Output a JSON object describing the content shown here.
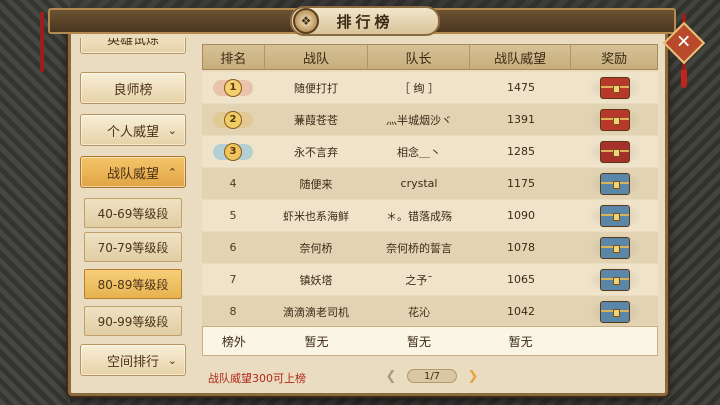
{
  "title": "排行榜",
  "close_icon": "close-icon",
  "sidebar": {
    "items": [
      {
        "label": "英雄试炼",
        "state": "partial"
      },
      {
        "label": "良师榜"
      },
      {
        "label": "个人威望",
        "chevron": "chevron-down-icon"
      },
      {
        "label": "战队威望",
        "chevron": "chevron-up-icon",
        "active": true
      },
      {
        "label": "空间排行",
        "chevron": "chevron-down-icon"
      }
    ],
    "sub_items": [
      {
        "label": "40-69等级段"
      },
      {
        "label": "70-79等级段"
      },
      {
        "label": "80-89等级段",
        "selected": true
      },
      {
        "label": "90-99等级段"
      }
    ]
  },
  "table": {
    "headers": [
      "排名",
      "战队",
      "队长",
      "战队威望",
      "奖励"
    ],
    "rows": [
      {
        "rank": "1",
        "team": "随便打打",
        "captain": "［ 绚 ］",
        "prestige": "1475",
        "medal": "gold",
        "reward": "red-chest"
      },
      {
        "rank": "2",
        "team": "蒹葭苍苍",
        "captain": "灬半城烟沙ヾ",
        "prestige": "1391",
        "medal": "gold",
        "reward": "red-chest"
      },
      {
        "rank": "3",
        "team": "永不言弃",
        "captain": "相念＿丶",
        "prestige": "1285",
        "medal": "blue",
        "reward": "red-chest"
      },
      {
        "rank": "4",
        "team": "随便来",
        "captain": "crystal",
        "prestige": "1175",
        "reward": "blue-chest"
      },
      {
        "rank": "5",
        "team": "虾米也系海鲜",
        "captain": "＊。错落成殇",
        "prestige": "1090",
        "reward": "blue-chest"
      },
      {
        "rank": "6",
        "team": "奈何桥",
        "captain": "奈何桥的誓言",
        "prestige": "1078",
        "reward": "blue-chest"
      },
      {
        "rank": "7",
        "team": "镇妖塔",
        "captain": "之予ˉ",
        "prestige": "1065",
        "reward": "blue-chest"
      },
      {
        "rank": "8",
        "team": "滴滴滴老司机",
        "captain": "花沁",
        "prestige": "1042",
        "reward": "blue-chest"
      }
    ],
    "footer": {
      "rank": "榜外",
      "team": "暂无",
      "captain": "暂无",
      "prestige": "暂无"
    }
  },
  "hint": "战队威望300可上榜",
  "pager": {
    "label": "1/7",
    "current": 1,
    "total": 7
  },
  "colors": {
    "frame_bg": "#e9dcc0",
    "accent_gold": "#e7b24f",
    "hint_red": "#b2281c",
    "close_red": "#b8492a"
  }
}
